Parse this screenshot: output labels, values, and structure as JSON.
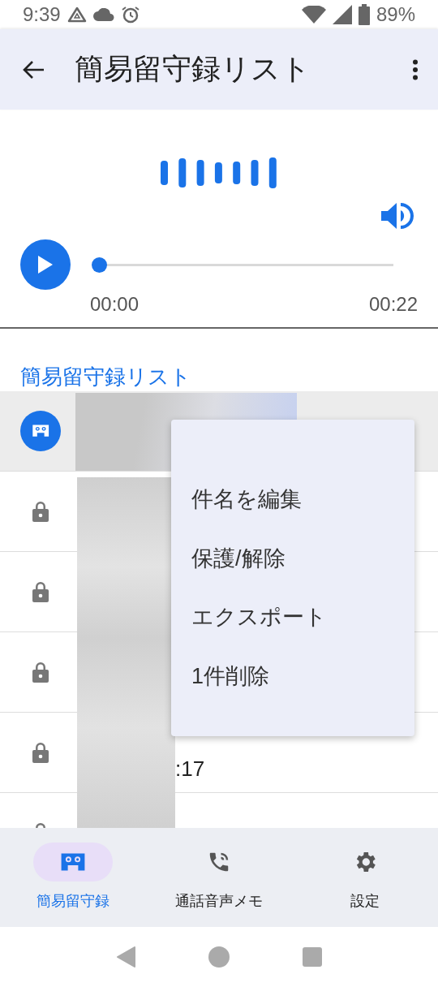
{
  "status_bar": {
    "time": "9:39",
    "battery": "89%"
  },
  "app_bar": {
    "title": "簡易留守録リスト"
  },
  "player": {
    "seek": {
      "level": 0
    },
    "elapsed": "00:00",
    "duration": "00:22"
  },
  "section_title": "簡易留守録リスト",
  "rows": [
    {
      "kind": "voicemail",
      "selected": true,
      "lines": []
    },
    {
      "kind": "locked",
      "selected": false,
      "lines": []
    },
    {
      "kind": "locked",
      "selected": false,
      "lines": []
    },
    {
      "kind": "locked",
      "selected": false,
      "lines": []
    },
    {
      "kind": "locked",
      "selected": false,
      "lines": [
        ":17"
      ]
    },
    {
      "kind": "locked",
      "selected": false,
      "lines": []
    }
  ],
  "context_menu": {
    "items": [
      "件名を編集",
      "保護/解除",
      "エクスポート",
      "1件削除"
    ]
  },
  "bottom_nav": [
    {
      "label": "簡易留守録",
      "selected": true
    },
    {
      "label": "通話音声メモ",
      "selected": false
    },
    {
      "label": "設定",
      "selected": false
    }
  ]
}
